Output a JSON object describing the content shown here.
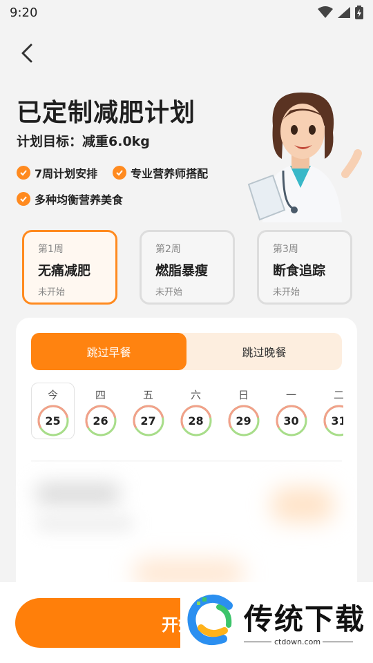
{
  "status": {
    "time": "9:20"
  },
  "hero": {
    "title": "已定制减肥计划",
    "goal": "计划目标：减重6.0kg",
    "features": [
      "7周计划安排",
      "专业营养师搭配",
      "多种均衡营养美食"
    ]
  },
  "weeks": [
    {
      "num": "第1周",
      "name": "无痛减肥",
      "status": "未开始"
    },
    {
      "num": "第2周",
      "name": "燃脂暴瘦",
      "status": "未开始"
    },
    {
      "num": "第3周",
      "name": "断食追踪",
      "status": "未开始"
    }
  ],
  "segments": [
    "跳过早餐",
    "跳过晚餐"
  ],
  "days": [
    {
      "label": "今",
      "date": "25"
    },
    {
      "label": "四",
      "date": "26"
    },
    {
      "label": "五",
      "date": "27"
    },
    {
      "label": "六",
      "date": "28"
    },
    {
      "label": "日",
      "date": "29"
    },
    {
      "label": "一",
      "date": "30"
    },
    {
      "label": "二",
      "date": "31"
    }
  ],
  "cta": {
    "label": "开始专"
  },
  "watermark": {
    "text": "传统下载",
    "url": "ctdown.com"
  },
  "colors": {
    "accent": "#ff8310",
    "ring_green": "#a8dd8a",
    "ring_red": "#f2a08a"
  }
}
